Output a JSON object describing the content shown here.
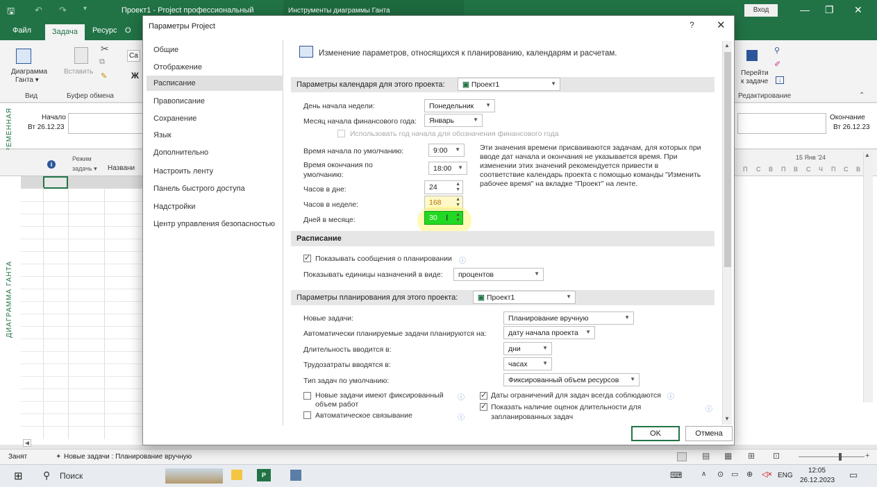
{
  "app": {
    "window_title": "Проект1 - Project профессиональный",
    "tools_tab": "Инструменты диаграммы Ганта",
    "signin": "Вход",
    "tabs": [
      "Файл",
      "Задача",
      "Ресурс",
      "О"
    ],
    "ribbon": {
      "gantt_label_1": "Диаграмма",
      "gantt_label_2": "Ганта ▾",
      "view_group": "Вид",
      "paste_label": "Вставить",
      "clipboard_group": "Буфер обмена",
      "font_partial": "Ca",
      "bold": "Ж",
      "goto_label_1": "Перейти",
      "goto_label_2": "к задаче",
      "editing_group": "Редактирование"
    },
    "timeline": {
      "vertical_label": "ВРЕМЕННАЯ",
      "start_label": "Начало",
      "start_date": "Вт 26.12.23",
      "end_label": "Окончание",
      "end_date": "Вт 26.12.23"
    },
    "grid": {
      "vertical_label": "ДИАГРАММА ГАНТА",
      "col_mode_1": "Режим",
      "col_mode_2": "задачь ▾",
      "col_name": "Названи",
      "week_label": "15 Янв '24",
      "days": [
        "П",
        "С",
        "В",
        "П",
        "В",
        "С",
        "Ч",
        "П",
        "С",
        "В"
      ]
    },
    "status": {
      "state": "Занят",
      "new_tasks": "Новые задачи : Планирование вручную"
    },
    "taskbar": {
      "search": "Поиск",
      "lang": "ENG",
      "time": "12:05",
      "date": "26.12.2023"
    }
  },
  "dialog": {
    "title": "Параметры Project",
    "help": "?",
    "close": "✕",
    "nav": [
      "Общие",
      "Отображение",
      "Расписание",
      "Правописание",
      "Сохранение",
      "Язык",
      "Дополнительно",
      "Настроить ленту",
      "Панель быстрого доступа",
      "Надстройки",
      "Центр управления безопасностью"
    ],
    "selected_nav": "Расписание",
    "header_text": "Изменение параметров, относящихся к планированию, календарям и расчетам.",
    "calendar_section": {
      "title": "Параметры календаря для этого проекта:",
      "project": "Проект1",
      "week_start_label": "День начала недели:",
      "week_start_value": "Понедельник",
      "fiscal_month_label": "Месяц начала финансового года:",
      "fiscal_month_value": "Январь",
      "use_start_year": "Использовать год начала для обозначения финансового года",
      "default_start_label": "Время начала по умолчанию:",
      "default_start_value": "9:00",
      "default_end_label_1": "Время окончания по",
      "default_end_label_2": "умолчанию:",
      "default_end_value": "18:00",
      "hours_day_label": "Часов в дне:",
      "hours_day_value": "24",
      "hours_week_label": "Часов в неделе:",
      "hours_week_value": "168",
      "days_month_label": "Дней в месяце:",
      "days_month_value": "30",
      "note": [
        "Эти значения времени присваиваются задачам, для которых при",
        "вводе дат начала и окончания не указывается время. При",
        "изменении этих значений рекомендуется привести в",
        "соответствие календарь проекта с помощью команды \"Изменить",
        "рабочее время\" на вкладке \"Проект\" на ленте."
      ]
    },
    "schedule_section": {
      "title": "Расписание",
      "show_messages": "Показывать сообщения о планировании",
      "units_label": "Показывать единицы назначений в виде:",
      "units_value": "процентов"
    },
    "planning_section": {
      "title": "Параметры планирования для этого проекта:",
      "project": "Проект1",
      "new_tasks_label": "Новые задачи:",
      "new_tasks_value": "Планирование вручную",
      "auto_label": "Автоматически планируемые задачи планируются на:",
      "auto_value": "дату начала проекта",
      "duration_label": "Длительность вводится в:",
      "duration_value": "дни",
      "work_label": "Трудозатраты вводятся в:",
      "work_value": "часах",
      "task_type_label": "Тип задач по умолчанию:",
      "task_type_value": "Фиксированный объем ресурсов",
      "effort_driven_1": "Новые задачи имеют фиксированный",
      "effort_driven_2": "объем работ",
      "auto_link": "Автоматическое связывание",
      "constraint_dates": "Даты ограничений для задач всегда соблюдаются",
      "estimated_1": "Показать наличие оценок длительности для",
      "estimated_2": "запланированных задач"
    },
    "ok": "OK",
    "cancel": "Отмена"
  }
}
